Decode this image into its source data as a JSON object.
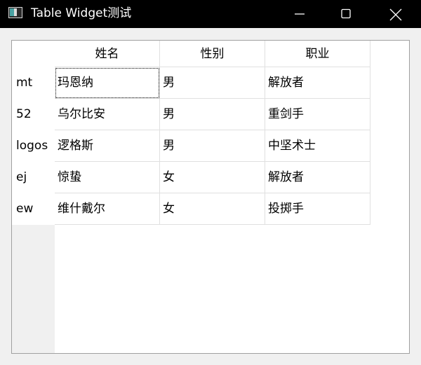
{
  "window": {
    "title": "Table Widget测试",
    "icon": "app-window-icon",
    "controls": [
      "minimize-icon",
      "maximize-icon",
      "close-icon"
    ]
  },
  "table": {
    "columns": [
      "姓名",
      "性别",
      "职业"
    ],
    "row_headers": [
      "mt",
      "52",
      "logos",
      "ej",
      "ew"
    ],
    "rows": [
      [
        "玛恩纳",
        "男",
        "解放者"
      ],
      [
        "乌尔比安",
        "男",
        "重剑手"
      ],
      [
        "逻格斯",
        "男",
        "中坚术士"
      ],
      [
        "惊蛰",
        "女",
        "解放者"
      ],
      [
        "维什戴尔",
        "女",
        "投掷手"
      ]
    ],
    "current_cell": [
      0,
      0
    ]
  }
}
